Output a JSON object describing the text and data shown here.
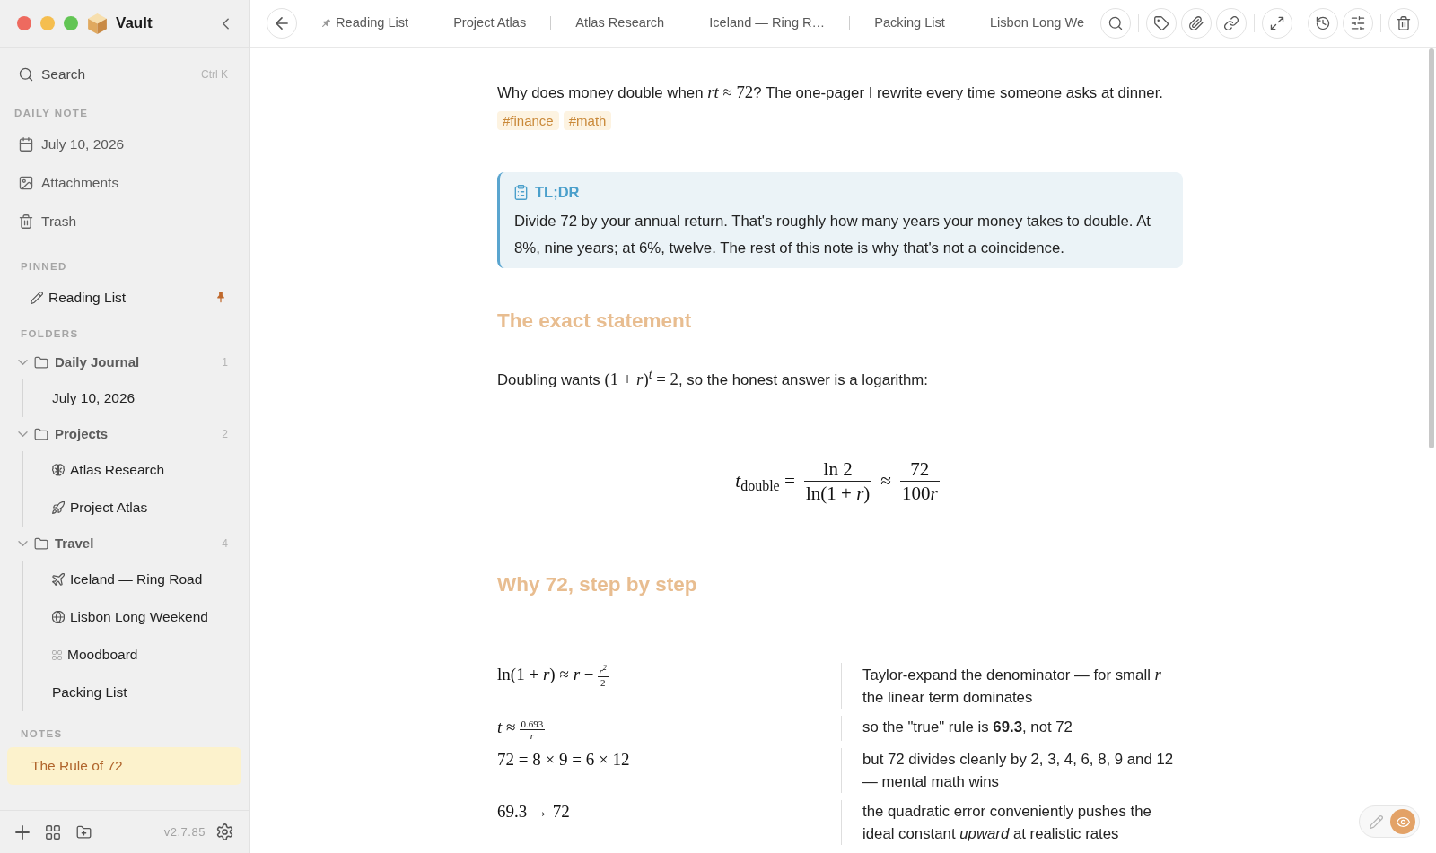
{
  "sidebar": {
    "app_name": "Vault",
    "search": {
      "label": "Search",
      "shortcut": "Ctrl K"
    },
    "daily_note": {
      "heading": "DAILY NOTE",
      "items": [
        {
          "kind": "calendar",
          "label": "July 10, 2026"
        },
        {
          "kind": "image",
          "label": "Attachments"
        },
        {
          "kind": "trash",
          "label": "Trash"
        }
      ]
    },
    "pinned": {
      "heading": "PINNED",
      "items": [
        {
          "kind": "pencil",
          "label": "Reading List",
          "selected": false,
          "pinned": true
        }
      ]
    },
    "folders": {
      "heading": "FOLDERS",
      "items": [
        {
          "label": "Daily Journal",
          "count": "1",
          "expanded": true,
          "children": [
            {
              "kind": "plain",
              "label": "July 10, 2026",
              "selected": false
            }
          ]
        },
        {
          "label": "Projects",
          "count": "2",
          "expanded": true,
          "children": [
            {
              "kind": "brain",
              "label": "Atlas Research",
              "selected": false
            },
            {
              "kind": "rocket",
              "label": "Project Atlas",
              "selected": false
            }
          ]
        },
        {
          "label": "Travel",
          "count": "4",
          "expanded": true,
          "children": [
            {
              "kind": "plane",
              "label": "Iceland — Ring Road",
              "selected": false
            },
            {
              "kind": "globe",
              "label": "Lisbon Long Weekend",
              "selected": false
            },
            {
              "kind": "grid",
              "label": "Moodboard",
              "selected": false
            },
            {
              "kind": "plain",
              "label": "Packing List",
              "selected": false
            }
          ]
        }
      ]
    },
    "notes": {
      "heading": "NOTES",
      "items": [
        {
          "label": "The Rule of 72",
          "selected": true
        }
      ]
    },
    "version": "v2.7.85"
  },
  "tabs": [
    {
      "label": "Reading List",
      "pinned": true,
      "divider_before": false,
      "selected": false
    },
    {
      "label": "Project Atlas",
      "pinned": false,
      "divider_before": false,
      "selected": false
    },
    {
      "label": "Atlas Research",
      "pinned": false,
      "divider_before": true,
      "selected": false
    },
    {
      "label": "Iceland — Ring R…",
      "pinned": false,
      "divider_before": false,
      "selected": false
    },
    {
      "label": "Packing List",
      "pinned": false,
      "divider_before": true,
      "selected": false
    },
    {
      "label": "Lisbon Long We",
      "pinned": false,
      "divider_before": false,
      "selected": false
    }
  ],
  "view_modes": [
    {
      "kind": "edit",
      "selected": false
    },
    {
      "kind": "preview",
      "selected": true
    }
  ],
  "note": {
    "blocks": [
      {
        "kind": "paragraph",
        "segments": [
          {
            "kind": "text",
            "text": "Why does money double when "
          },
          {
            "kind": "math",
            "text": "*rt* ≈ 72"
          },
          {
            "kind": "text",
            "text": "? The one-pager I rewrite every time someone asks at dinner."
          }
        ]
      },
      {
        "kind": "tags",
        "items": [
          "#finance",
          "#math"
        ]
      },
      {
        "kind": "callout",
        "title": "TL;DR",
        "body": "Divide 72 by your annual return. That's roughly how many years your money takes to double. At 8%, nine years; at 6%, twelve. The rest of this note is why that's not a coincidence."
      },
      {
        "kind": "heading",
        "text": "The exact statement"
      },
      {
        "kind": "paragraph",
        "segments": [
          {
            "kind": "text",
            "text": "Doubling wants "
          },
          {
            "kind": "math",
            "text": "(1 + *r*)$^{t}$ = 2"
          },
          {
            "kind": "text",
            "text": ", so the honest answer is a logarithm:"
          }
        ]
      },
      {
        "kind": "equation",
        "segments": [
          {
            "kind": "math",
            "text": "*t*$_{double}$ ="
          },
          {
            "kind": "frac",
            "num": [
              "ln 2"
            ],
            "den": [
              "ln(1 + *r*)"
            ]
          },
          {
            "kind": "math",
            "text": "≈"
          },
          {
            "kind": "frac",
            "num": [
              "72"
            ],
            "den": [
              "100",
              "*r*"
            ]
          }
        ]
      },
      {
        "kind": "heading",
        "text": "Why 72, step by step"
      },
      {
        "kind": "steps",
        "rows": [
          {
            "formula": [
              {
                "kind": "math",
                "text": "ln(1 + *r*) ≈ *r* −"
              },
              {
                "kind": "frac",
                "num": [
                  "*r*$^{2}$"
                ],
                "den": [
                  "2"
                ]
              }
            ],
            "explanation": [
              {
                "kind": "text",
                "text": "Taylor-expand the denominator — for small "
              },
              {
                "kind": "math",
                "text": "*r*"
              },
              {
                "kind": "text",
                "text": " the linear term dominates"
              }
            ]
          },
          {
            "formula": [
              {
                "kind": "math",
                "text": "*t* ≈"
              },
              {
                "kind": "frac",
                "num": [
                  "0.693"
                ],
                "den": [
                  "*r*"
                ]
              }
            ],
            "explanation": [
              {
                "kind": "text",
                "text": "so the \"true\" rule is **69.3**, not 72"
              }
            ]
          },
          {
            "formula": [
              {
                "kind": "math",
                "text": "72 = 8 × 9 = 6 × 12"
              }
            ],
            "explanation": [
              {
                "kind": "text",
                "text": "but 72 divides cleanly by 2, 3, 4, 6, 8, 9 and 12 — mental math wins"
              }
            ]
          },
          {
            "formula": [
              {
                "kind": "math",
                "text": "69.3 → 72"
              }
            ],
            "explanation": [
              {
                "kind": "text",
                "text": "the quadratic error conveniently pushes the ideal constant *upward* at realistic rates"
              }
            ]
          }
        ]
      }
    ]
  }
}
